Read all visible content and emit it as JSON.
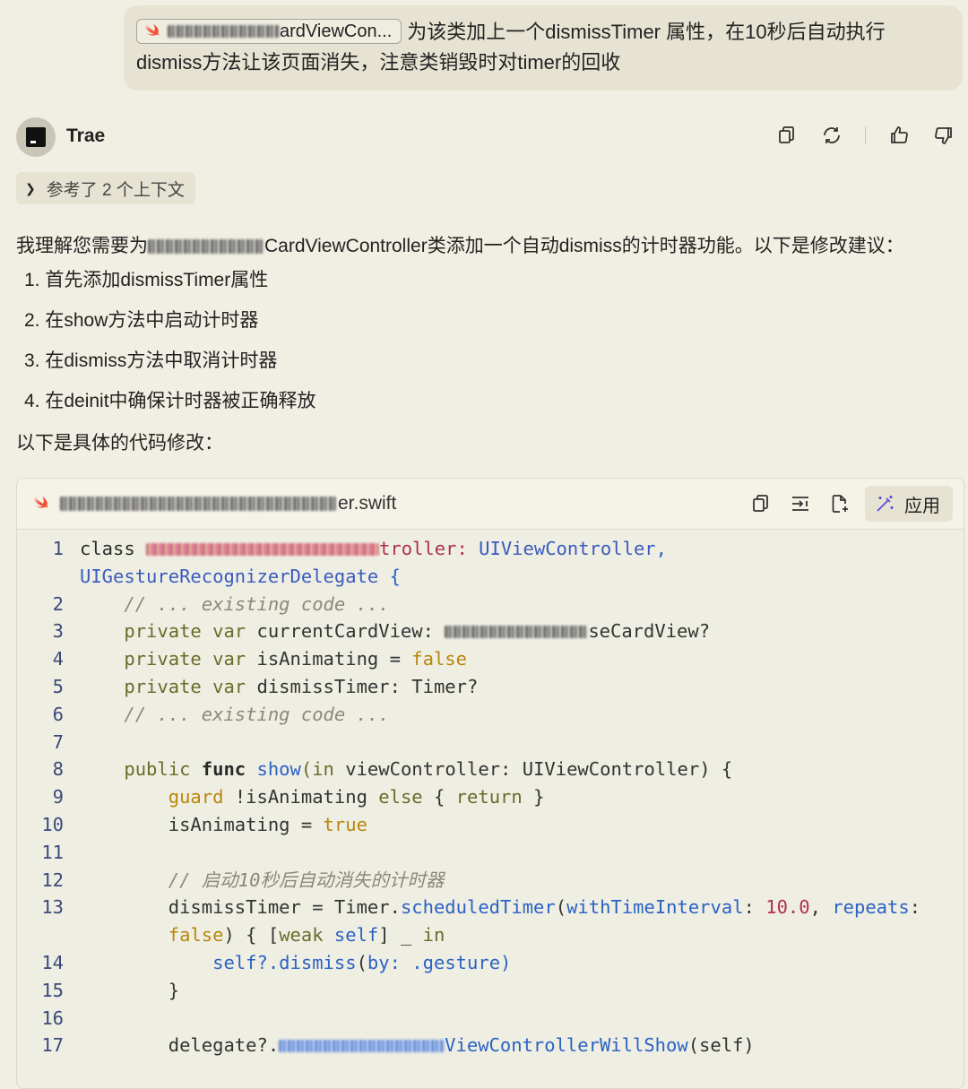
{
  "user_message": {
    "file_chip": {
      "icon": "swift-icon",
      "label_visible_suffix": "ardViewCon..."
    },
    "text_line1": "为该类加上一个dismissTimer 属性，在10秒后自动执行",
    "text_line2": "dismiss方法让该页面消失，注意类销毁时对timer的回收"
  },
  "assistant": {
    "name": "Trae",
    "actions": [
      "copy-icon",
      "refresh-icon",
      "thumbs-up-icon",
      "thumbs-down-icon"
    ]
  },
  "context_pill": "参考了 2 个上下文",
  "intro": {
    "prefix": "我理解您需要为",
    "suffix": "CardViewController类添加一个自动dismiss的计时器功能。以下是修改建议："
  },
  "steps": [
    "1. 首先添加dismissTimer属性",
    "2. 在show方法中启动计时器",
    "3. 在dismiss方法中取消计时器",
    "4. 在deinit中确保计时器被正确释放"
  ],
  "outro": "以下是具体的代码修改：",
  "code_block": {
    "filename_suffix": "er.swift",
    "apply_label": "应用",
    "line_numbers": [
      "1",
      "",
      "2",
      "3",
      "4",
      "5",
      "6",
      "7",
      "8",
      "9",
      "10",
      "11",
      "12",
      "13",
      "",
      "14",
      "15",
      "16",
      "17"
    ],
    "text": {
      "l1_kw": "class ",
      "l1_tail": "troller: ",
      "l1_type1": "UIViewController,",
      "l1b_type": "UIGestureRecognizerDelegate",
      "l1b_brace": " {",
      "l2": "// ... existing code ...",
      "l3_a": "private var ",
      "l3_b": "currentCardView: ",
      "l3_c": "seCardView?",
      "l4_a": "private var ",
      "l4_b": "isAnimating = ",
      "l4_c": "false",
      "l5_a": "private var ",
      "l5_b": "dismissTimer: Timer?",
      "l6": "// ... existing code ...",
      "l8_a": "public ",
      "l8_b": "func ",
      "l8_c": "show",
      "l8_d": "(in ",
      "l8_e": "viewController: UIViewController) {",
      "l9_a": "guard ",
      "l9_b": "!isAnimating ",
      "l9_c": "else ",
      "l9_d": "{ ",
      "l9_e": "return",
      "l9_f": " }",
      "l10_a": "isAnimating = ",
      "l10_b": "true",
      "l12": "// 启动10秒后自动消失的计时器",
      "l13_a": "dismissTimer = Timer.",
      "l13_b": "scheduledTimer",
      "l13_c": "(",
      "l13_d": "withTimeInterval",
      "l13_e": ": ",
      "l13_f": "10.0",
      "l13_g": ", ",
      "l13_h": "repeats",
      "l13_i": ":",
      "l13b_a": "false",
      "l13b_b": ") { [",
      "l13b_c": "weak ",
      "l13b_d": "self",
      "l13b_e": "] _ ",
      "l13b_f": "in",
      "l14_a": "self?.",
      "l14_b": "dismiss",
      "l14_c": "(",
      "l14_d": "by",
      "l14_e": ": .gesture)",
      "l15": "}",
      "l17_a": "delegate?.",
      "l17_b": "ViewControllerWillShow",
      "l17_c": "(self)"
    }
  },
  "colors": {
    "background": "#f1efe3",
    "bubble": "#e6e3d3",
    "keyword": "#6b6b2a",
    "bool": "#b8860b",
    "type": "#3a5bbf",
    "comment": "#8a8a78",
    "number": "#b03050"
  }
}
